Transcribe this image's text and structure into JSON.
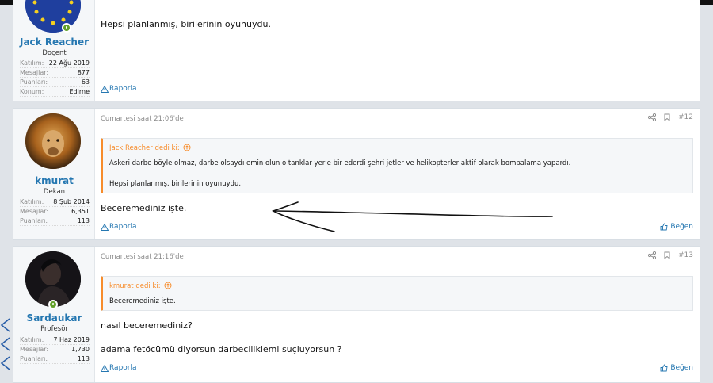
{
  "posts": [
    {
      "user": {
        "name": "Jack Reacher",
        "title": "Doçent"
      },
      "stats": [
        {
          "label": "Katılım:",
          "value": "22 Ağu 2019"
        },
        {
          "label": "Mesajlar:",
          "value": "877"
        },
        {
          "label": "Puanları:",
          "value": "63"
        },
        {
          "label": "Konum:",
          "value": "Edirne"
        }
      ],
      "message": [
        "Hepsi planlanmış, birilerinin oyunuydu."
      ],
      "report_label": "Raporla"
    },
    {
      "user": {
        "name": "kmurat",
        "title": "Dekan"
      },
      "stats": [
        {
          "label": "Katılım:",
          "value": "8 Şub 2014"
        },
        {
          "label": "Mesajlar:",
          "value": "6,351"
        },
        {
          "label": "Puanları:",
          "value": "113"
        }
      ],
      "date": "Cumartesi saat 21:06'de",
      "post_number": "#12",
      "quote": {
        "author": "Jack Reacher dedi ki:",
        "lines": [
          "Askeri darbe böyle olmaz, darbe olsaydı emin olun o tanklar yerle bir ederdi şehri jetler ve helikopterler aktif olarak bombalama yapardı.",
          "Hepsi planlanmış, birilerinin oyunuydu."
        ]
      },
      "message": [
        "Beceremediniz işte."
      ],
      "report_label": "Raporla",
      "like_label": "Beğen"
    },
    {
      "user": {
        "name": "Sardaukar",
        "title": "Profesör"
      },
      "stats": [
        {
          "label": "Katılım:",
          "value": "7 Haz 2019"
        },
        {
          "label": "Mesajlar:",
          "value": "1,730"
        },
        {
          "label": "Puanları:",
          "value": "113"
        }
      ],
      "date": "Cumartesi saat 21:16'de",
      "post_number": "#13",
      "quote": {
        "author": "kmurat dedi ki:",
        "lines": [
          "Beceremediniz işte."
        ]
      },
      "message": [
        "nasıl beceremediniz?",
        "adama fetöcümü diyorsun darbeciliklemi suçluyorsun ?"
      ],
      "report_label": "Raporla",
      "like_label": "Beğen"
    }
  ],
  "colors": {
    "link": "#2577b1",
    "quote_accent": "#f78c2b",
    "online": "#62a12a"
  },
  "icons": [
    "share-icon",
    "bookmark-icon",
    "warning-icon",
    "like-icon",
    "arrow-up-circle-icon",
    "online-icon"
  ]
}
